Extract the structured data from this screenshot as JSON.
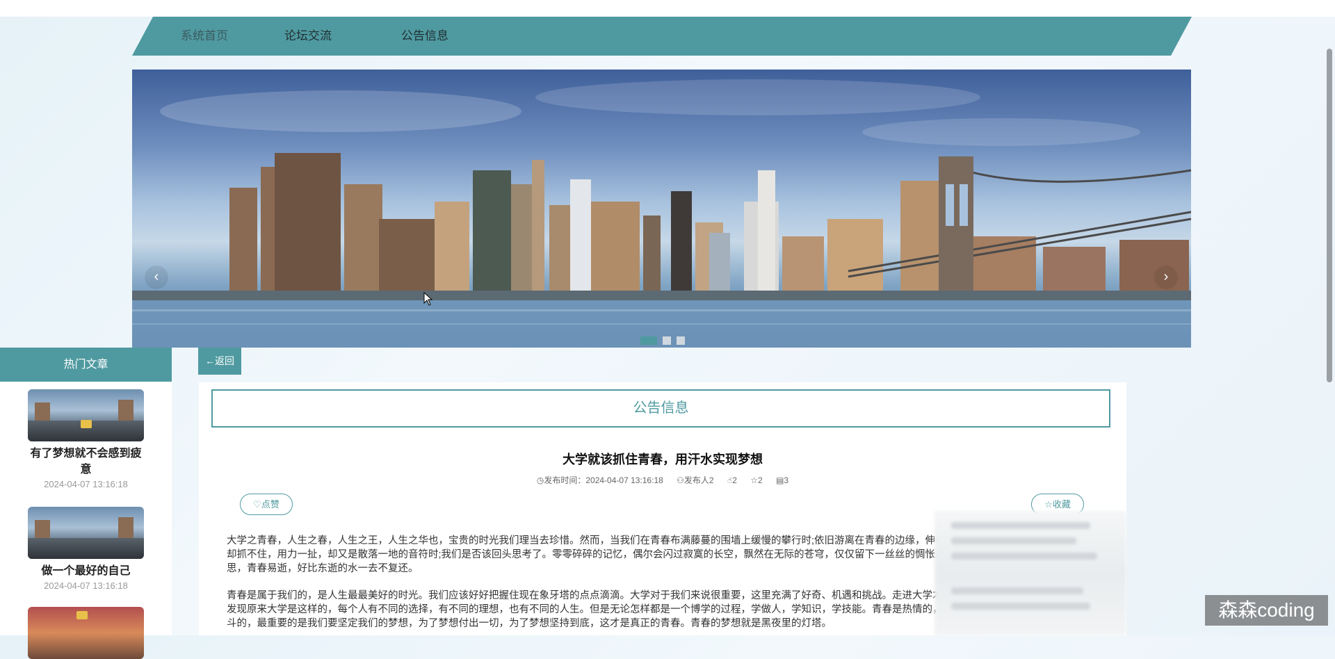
{
  "nav": {
    "items": [
      {
        "label": "系统首页"
      },
      {
        "label": "论坛交流"
      },
      {
        "label": "公告信息"
      }
    ]
  },
  "banner": {
    "prev_symbol": "‹",
    "next_symbol": "›",
    "slide_count": 3,
    "active_slide": 1
  },
  "sidebar": {
    "title": "热门文章",
    "articles": [
      {
        "title": "有了梦想就不会感到疲意",
        "date": "2024-04-07 13:16:18"
      },
      {
        "title": "做一个最好的自己",
        "date": "2024-04-07 13:16:18"
      }
    ]
  },
  "back_button": {
    "label": "←返回"
  },
  "section": {
    "title": "公告信息"
  },
  "article": {
    "title": "大学就该抓住青春，用汗水实现梦想",
    "meta": {
      "publish_time_label": "发布时间：2024-04-07 13:16:18",
      "publisher": "发布人2",
      "likes": "2",
      "favorites": "2",
      "comments": "3"
    },
    "like_button": "点赞",
    "favorite_button": "收藏",
    "paragraphs": [
      "大学之青春，人生之春，人生之王，人生之华也，宝贵的时光我们理当去珍惜。然而，当我们在青春布满藤蔓的围墙上缓慢的攀行时;依旧游离在青春的边缘，伸手抓却抓不住，用力一扯，却又是散落一地的音符时;我们是否该回头思考了。零零碎碎的记忆，偶尔会闪过寂寞的长空，飘然在无际的苍穹，仅仅留下一丝丝的惆怅与哀思，青春易逝，好比东逝的水一去不复还。",
      "青春是属于我们的，是人生最最美好的时光。我们应该好好把握住现在象牙塔的点点滴滴。大学对于我们来说很重要，这里充满了好奇、机遇和挑战。走进大学才突然发现原来大学是这样的，每个人有不同的选择，有不同的理想，也有不同的人生。但是无论怎样都是一个博学的过程，学做人，学知识，学技能。青春是热情的，是奋斗的，最重要的是我们要坚定我们的梦想，为了梦想付出一切，为了梦想坚持到底，这才是真正的青春。青春的梦想就是黑夜里的灯塔。"
    ]
  },
  "watermark": "森森coding",
  "colors": {
    "accent": "#4f9aa0",
    "background": "#eaf3f9"
  }
}
